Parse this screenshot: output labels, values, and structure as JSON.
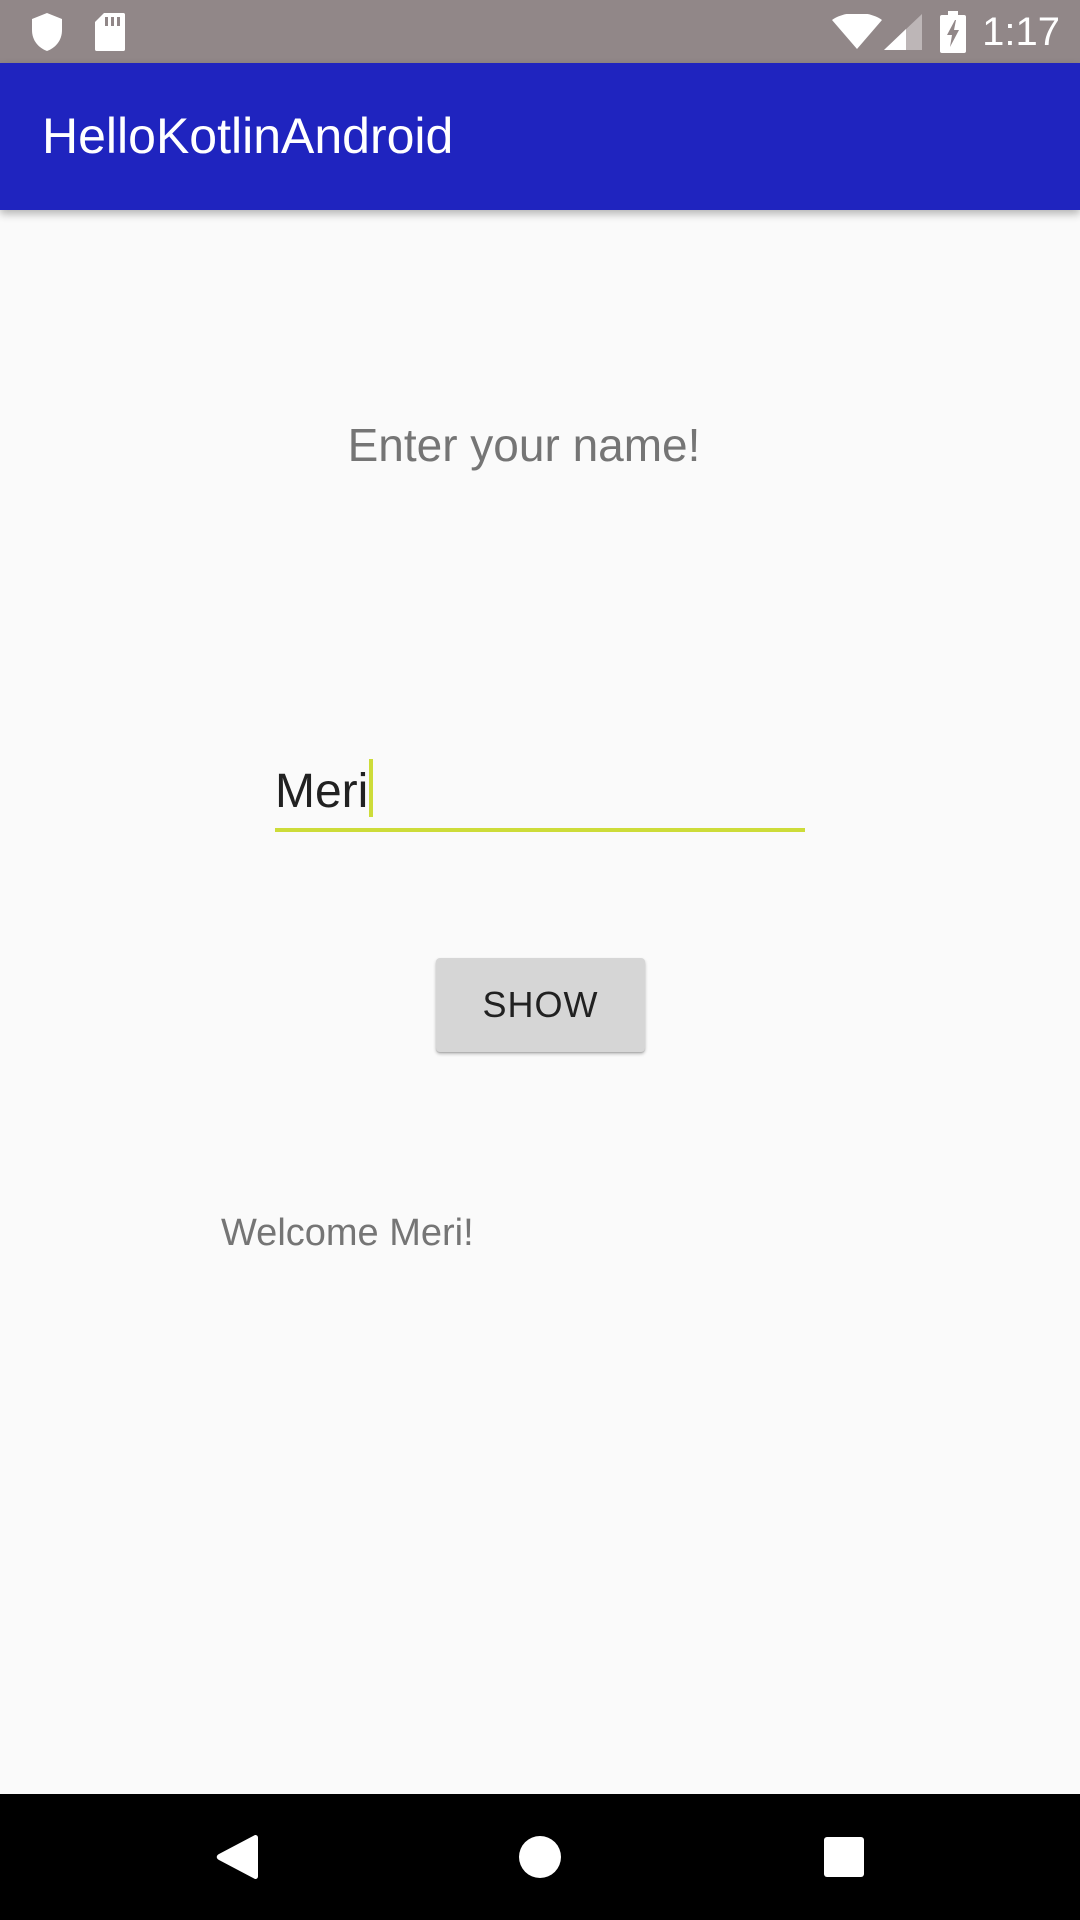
{
  "status_bar": {
    "time": "1:17",
    "left_icons": [
      "shield-icon",
      "sd-card-icon"
    ],
    "right_icons": [
      "wifi-icon",
      "signal-icon",
      "battery-charging-icon"
    ]
  },
  "app_bar": {
    "title": "HelloKotlinAndroid",
    "color": "#1f24bf"
  },
  "main": {
    "prompt": "Enter your name!",
    "name_input": {
      "value": "Meri",
      "underline_color": "#cddc39"
    },
    "show_button": {
      "label": "SHOW"
    },
    "welcome": "Welcome Meri!"
  },
  "nav_bar": {
    "buttons": [
      "back-icon",
      "home-icon",
      "recents-icon"
    ]
  }
}
